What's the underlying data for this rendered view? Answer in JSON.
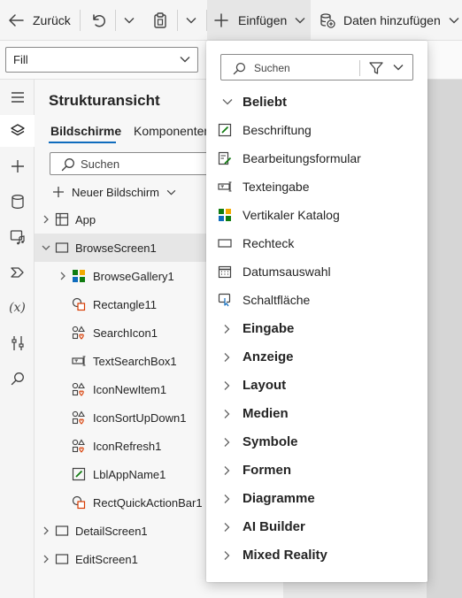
{
  "toolbar": {
    "back_label": "Zurück",
    "insert_label": "Einfügen",
    "add_data_label": "Daten hinzufügen"
  },
  "formula": {
    "property_value": "Fill"
  },
  "tree": {
    "title": "Strukturansicht",
    "tabs": [
      {
        "label": "Bildschirme"
      },
      {
        "label": "Komponenten"
      }
    ],
    "search_placeholder": "Suchen",
    "new_screen_label": "Neuer Bildschirm",
    "items": [
      {
        "label": "App"
      },
      {
        "label": "BrowseScreen1"
      },
      {
        "label": "BrowseGallery1"
      },
      {
        "label": "Rectangle11"
      },
      {
        "label": "SearchIcon1"
      },
      {
        "label": "TextSearchBox1"
      },
      {
        "label": "IconNewItem1"
      },
      {
        "label": "IconSortUpDown1"
      },
      {
        "label": "IconRefresh1"
      },
      {
        "label": "LblAppName1"
      },
      {
        "label": "RectQuickActionBar1"
      },
      {
        "label": "DetailScreen1"
      },
      {
        "label": "EditScreen1"
      }
    ]
  },
  "insert_menu": {
    "search_placeholder": "Suchen",
    "popular_header": "Beliebt",
    "popular_items": [
      {
        "label": "Beschriftung",
        "icon": "label-edit-icon"
      },
      {
        "label": "Bearbeitungsformular",
        "icon": "edit-form-icon"
      },
      {
        "label": "Texteingabe",
        "icon": "text-input-icon"
      },
      {
        "label": "Vertikaler Katalog",
        "icon": "gallery-icon"
      },
      {
        "label": "Rechteck",
        "icon": "rectangle-icon"
      },
      {
        "label": "Datumsauswahl",
        "icon": "calendar-icon"
      },
      {
        "label": "Schaltfläche",
        "icon": "button-icon"
      }
    ],
    "categories": [
      {
        "label": "Eingabe"
      },
      {
        "label": "Anzeige"
      },
      {
        "label": "Layout"
      },
      {
        "label": "Medien"
      },
      {
        "label": "Symbole"
      },
      {
        "label": "Formen"
      },
      {
        "label": "Diagramme"
      },
      {
        "label": "AI Builder"
      },
      {
        "label": "Mixed Reality"
      }
    ]
  },
  "colors": {
    "accent": "#0f6cbd",
    "icon_green": "#107c10",
    "icon_orange": "#d83b01"
  }
}
